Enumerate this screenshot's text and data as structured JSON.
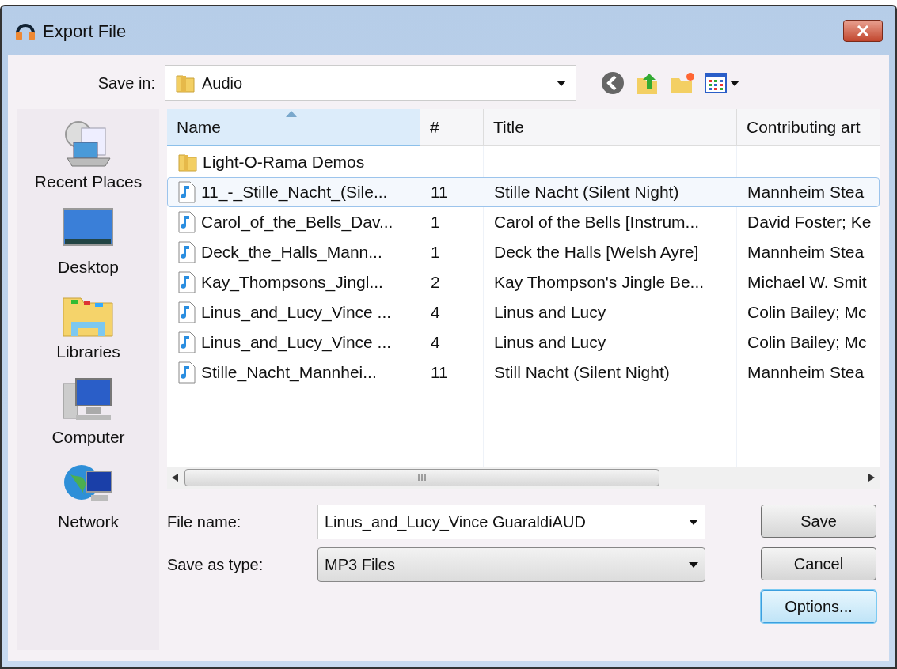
{
  "window": {
    "title": "Export File"
  },
  "save_in": {
    "label": "Save in:",
    "value": "Audio"
  },
  "places": [
    {
      "label": "Recent Places",
      "kind": "recent"
    },
    {
      "label": "Desktop",
      "kind": "desktop"
    },
    {
      "label": "Libraries",
      "kind": "libraries"
    },
    {
      "label": "Computer",
      "kind": "computer"
    },
    {
      "label": "Network",
      "kind": "network"
    }
  ],
  "table": {
    "columns": [
      "Name",
      "#",
      "Title",
      "Contributing art"
    ],
    "rows": [
      {
        "kind": "folder",
        "selected": false,
        "cells": [
          "Light-O-Rama Demos",
          "",
          "",
          ""
        ]
      },
      {
        "kind": "audio",
        "selected": true,
        "cells": [
          "11_-_Stille_Nacht_(Sile...",
          "11",
          "Stille Nacht (Silent Night)",
          "Mannheim Stea"
        ]
      },
      {
        "kind": "audio",
        "selected": false,
        "cells": [
          "Carol_of_the_Bells_Dav...",
          "1",
          "Carol of the Bells [Instrum...",
          "David Foster; Ke"
        ]
      },
      {
        "kind": "audio",
        "selected": false,
        "cells": [
          "Deck_the_Halls_Mann...",
          "1",
          "Deck the Halls [Welsh Ayre]",
          "Mannheim Stea"
        ]
      },
      {
        "kind": "audio",
        "selected": false,
        "cells": [
          "Kay_Thompsons_Jingl...",
          "2",
          "Kay Thompson's Jingle Be...",
          "Michael W. Smit"
        ]
      },
      {
        "kind": "audio",
        "selected": false,
        "cells": [
          "Linus_and_Lucy_Vince ...",
          "4",
          "Linus and Lucy",
          "Colin Bailey; Mc"
        ]
      },
      {
        "kind": "audio",
        "selected": false,
        "cells": [
          "Linus_and_Lucy_Vince ...",
          "4",
          "Linus and Lucy",
          "Colin Bailey; Mc"
        ]
      },
      {
        "kind": "audio",
        "selected": false,
        "cells": [
          "Stille_Nacht_Mannhei...",
          "11",
          "Still Nacht (Silent Night)",
          "Mannheim Stea"
        ]
      }
    ]
  },
  "file_name": {
    "label": "File name:",
    "value": "Linus_and_Lucy_Vince GuaraldiAUD"
  },
  "save_as_type": {
    "label": "Save as type:",
    "value": "MP3 Files"
  },
  "buttons": [
    {
      "label": "Save",
      "selected": false
    },
    {
      "label": "Cancel",
      "selected": false
    },
    {
      "label": "Options...",
      "selected": true
    }
  ]
}
